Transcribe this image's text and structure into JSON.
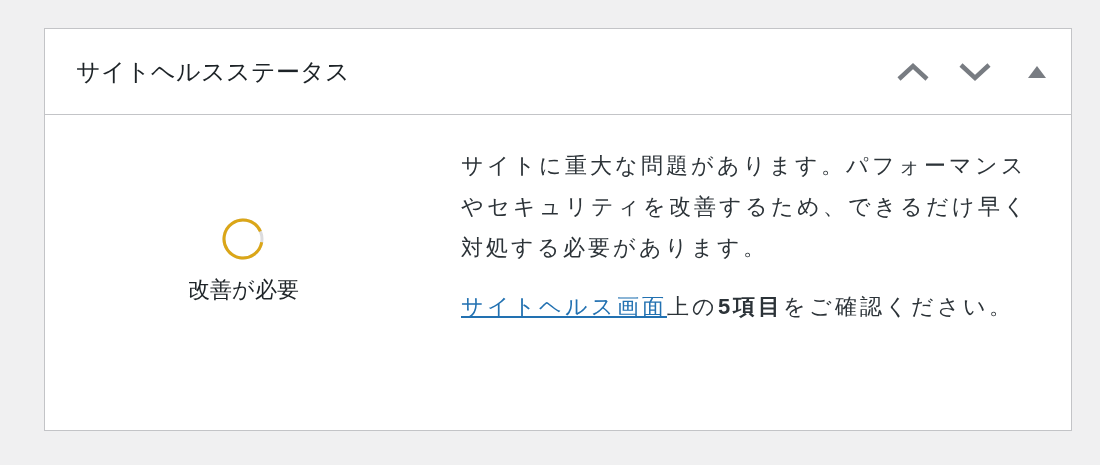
{
  "widget": {
    "title": "サイトヘルスステータス",
    "controls": [
      {
        "kind": "up"
      },
      {
        "kind": "down"
      },
      {
        "kind": "toggle"
      }
    ]
  },
  "status": {
    "label": "改善が必要"
  },
  "description": "サイトに重大な問題があります。パフォーマンスやセキュリティを改善するため、できるだけ早く対処する必要があります。",
  "action": {
    "link": "サイトヘルス画面",
    "text": "上の**5項目**をご確認ください。"
  }
}
